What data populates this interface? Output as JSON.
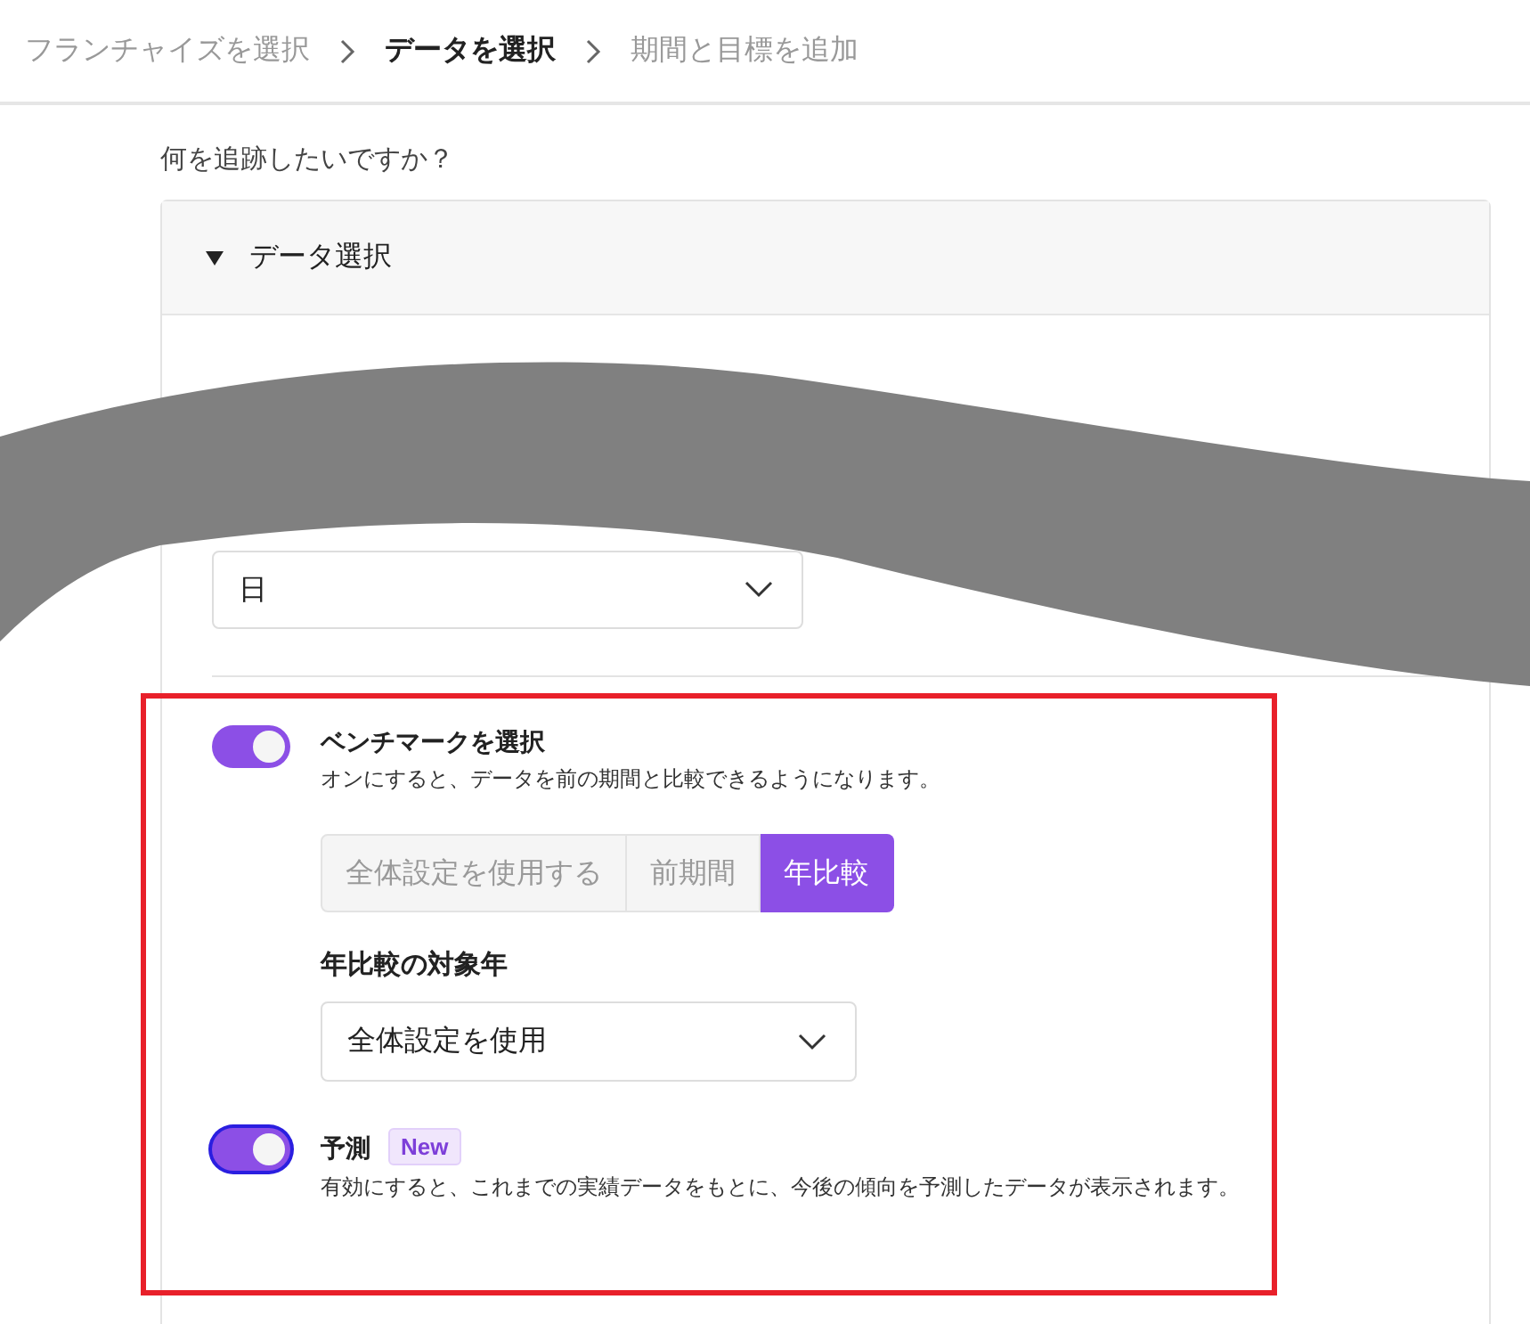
{
  "breadcrumb": [
    {
      "label": "フランチャイズを選択",
      "selected": false
    },
    {
      "label": "データを選択",
      "selected": true
    },
    {
      "label": "期間と目標を追加",
      "selected": false
    }
  ],
  "question": "何を追跡したいですか？",
  "panel": {
    "title": "データ選択",
    "expanded": true,
    "time_select": {
      "value": "日"
    },
    "benchmark": {
      "on": true,
      "title": "ベンチマークを選択",
      "description": "オンにすると、データを前の期間と比較できるようになります。",
      "options": [
        {
          "label": "全体設定を使用する",
          "selected": false
        },
        {
          "label": "前期間",
          "selected": false
        },
        {
          "label": "年比較",
          "selected": true
        }
      ],
      "year_label": "年比較の対象年",
      "year_select": {
        "value": "全体設定を使用"
      }
    },
    "forecast": {
      "on": true,
      "focused": true,
      "title": "予測",
      "badge": "New",
      "description": "有効にすると、これまでの実績データをもとに、今後の傾向を予測したデータが表示されます。"
    }
  }
}
